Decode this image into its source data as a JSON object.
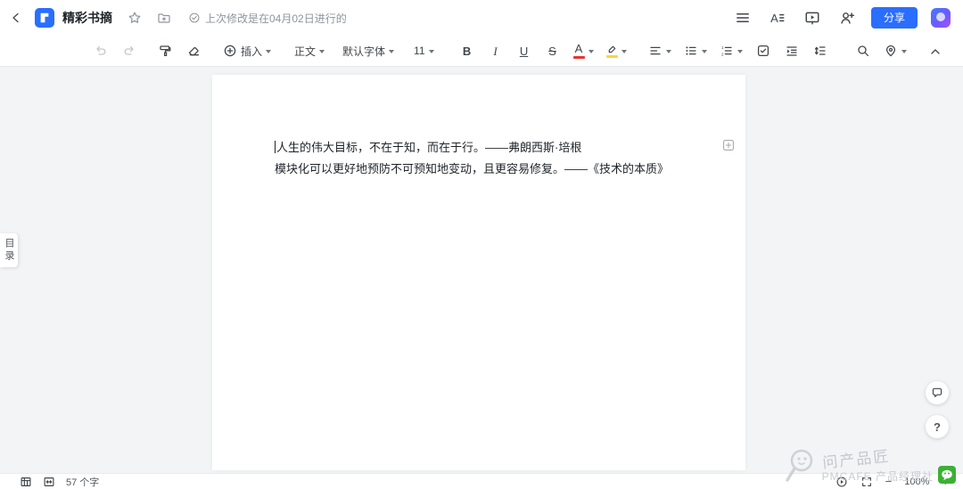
{
  "topbar": {
    "title": "精彩书摘",
    "saved_status": "上次修改是在04月02日进行的",
    "share_label": "分享"
  },
  "toolbar": {
    "insert_label": "插入",
    "paragraph_style": "正文",
    "font_name": "默认字体",
    "font_size": "11",
    "bold_label": "B",
    "italic_label": "I",
    "underline_label": "U",
    "strikethrough_label": "S",
    "font_color_label": "A"
  },
  "toc_tab": {
    "label": "目录"
  },
  "document": {
    "lines": [
      "人生的伟大目标，不在于知，而在于行。——弗朗西斯·培根",
      "模块化可以更好地预防不可预知地变动，且更容易修复。——《技术的本质》"
    ]
  },
  "statusbar": {
    "word_count": "57 个字",
    "zoom_level": "100%",
    "zoom_out": "−",
    "zoom_in": "+"
  },
  "floating": {
    "help_label": "?"
  },
  "watermark": {
    "name": "问产品匠",
    "community": "PMCAFE 产品经理社"
  },
  "colors": {
    "accent": "#2a6eff",
    "highlight_yellow": "#ffd43b",
    "font_color_red": "#e8352e",
    "wechat_green": "#3cb034"
  }
}
